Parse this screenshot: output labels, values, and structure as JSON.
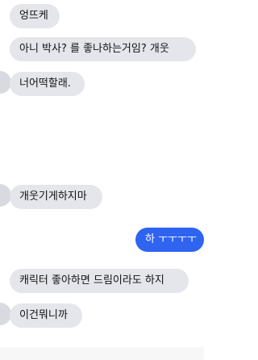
{
  "messages": [
    {
      "sender": "other",
      "text": "엉뜨케"
    },
    {
      "sender": "other",
      "text": "아니 박사? 를 좋나하는거임? 개웃"
    },
    {
      "sender": "other",
      "text": "너어떡할래."
    },
    {
      "sender": "other",
      "text": "개웃기게하지마"
    },
    {
      "sender": "self",
      "text": "하 ㅜㅜㅜㅜ"
    },
    {
      "sender": "other",
      "text": "캐릭터 좋아하면 드림이라도 하지"
    },
    {
      "sender": "other",
      "text": "이건뭐니까"
    }
  ],
  "colors": {
    "incoming_bubble": "#e4e6eb",
    "outgoing_bubble": "#2f64f0",
    "avatar": "#d8dadf"
  }
}
